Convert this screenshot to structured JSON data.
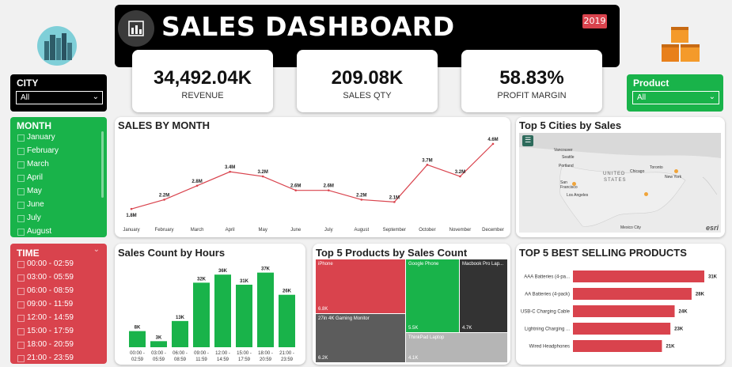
{
  "header": {
    "title": "SALES DASHBOARD",
    "year_badge": "2019"
  },
  "kpis": [
    {
      "value": "34,492.04K",
      "label": "REVENUE"
    },
    {
      "value": "209.08K",
      "label": "SALES QTY"
    },
    {
      "value": "58.83%",
      "label": "PROFIT MARGIN"
    }
  ],
  "city_slicer": {
    "title": "CITY",
    "selected": "All"
  },
  "product_slicer": {
    "title": "Product",
    "selected": "All"
  },
  "month_slicer": {
    "title": "MONTH",
    "items": [
      "January",
      "February",
      "March",
      "April",
      "May",
      "June",
      "July",
      "August"
    ]
  },
  "time_slicer": {
    "title": "TIME",
    "items": [
      "00:00 - 02:59",
      "03:00 - 05:59",
      "06:00 - 08:59",
      "09:00 - 11:59",
      "12:00 - 14:59",
      "15:00 - 17:59",
      "18:00 - 20:59",
      "21:00 - 23:59"
    ]
  },
  "cards": {
    "sales_by_month": "SALES BY MONTH",
    "top_cities": "Top 5 Cities by Sales",
    "sales_by_hours": "Sales Count by Hours",
    "top_products": "Top 5 Products by Sales Count",
    "best_selling": "TOP 5 BEST SELLING PRODUCTS"
  },
  "colors": {
    "accent_red": "#d9434d",
    "accent_green": "#19b34a",
    "dark_gray": "#333333"
  },
  "chart_data": [
    {
      "type": "line",
      "title": "SALES BY MONTH",
      "categories": [
        "January",
        "February",
        "March",
        "April",
        "May",
        "June",
        "July",
        "August",
        "September",
        "October",
        "November",
        "December"
      ],
      "values": [
        1.8,
        2.2,
        2.8,
        3.4,
        3.2,
        2.6,
        2.6,
        2.2,
        2.1,
        3.7,
        3.2,
        4.6
      ],
      "labels": [
        "1.8M",
        "2.2M",
        "2.8M",
        "3.4M",
        "3.2M",
        "2.6M",
        "2.6M",
        "2.2M",
        "2.1M",
        "3.7M",
        "3.2M",
        "4.6M"
      ],
      "ylim": [
        1.5,
        4.8
      ]
    },
    {
      "type": "bar",
      "title": "Sales Count by Hours",
      "categories": [
        "00:00 - 02:59",
        "03:00 - 05:59",
        "06:00 - 08:59",
        "09:00 - 11:59",
        "12:00 - 14:59",
        "15:00 - 17:59",
        "18:00 - 20:59",
        "21:00 - 23:59"
      ],
      "values": [
        8,
        3,
        13,
        32,
        36,
        31,
        37,
        26
      ],
      "labels": [
        "8K",
        "3K",
        "13K",
        "32K",
        "36K",
        "31K",
        "37K",
        "26K"
      ],
      "ylim": [
        0,
        40
      ]
    },
    {
      "type": "treemap",
      "title": "Top 5 Products by Sales Count",
      "items": [
        {
          "name": "iPhone",
          "value": "6.8K"
        },
        {
          "name": "27in 4K Gaming Monitor",
          "value": "6.2K"
        },
        {
          "name": "Google Phone",
          "value": "5.5K"
        },
        {
          "name": "Macbook Pro Lap...",
          "value": "4.7K"
        },
        {
          "name": "ThinkPad Laptop",
          "value": "4.1K"
        }
      ]
    },
    {
      "type": "bar",
      "orientation": "horizontal",
      "title": "TOP 5 BEST SELLING PRODUCTS",
      "categories": [
        "AAA Batteries (4-pa...",
        "AA Batteries (4-pack)",
        "USB-C Charging Cable",
        "Lightning Charging ...",
        "Wired Headphones"
      ],
      "values": [
        31,
        28,
        24,
        23,
        21
      ],
      "labels": [
        "31K",
        "28K",
        "24K",
        "23K",
        "21K"
      ],
      "xlim": [
        0,
        31
      ]
    }
  ],
  "map": {
    "city_labels": [
      "Vancouver",
      "Seattle",
      "Portland",
      "San Francisco",
      "Los Angeles",
      "Chicago",
      "Toronto",
      "New York",
      "Mexico City"
    ],
    "region_labels": [
      "UNITED",
      "STATES"
    ],
    "attribution": "esri"
  }
}
